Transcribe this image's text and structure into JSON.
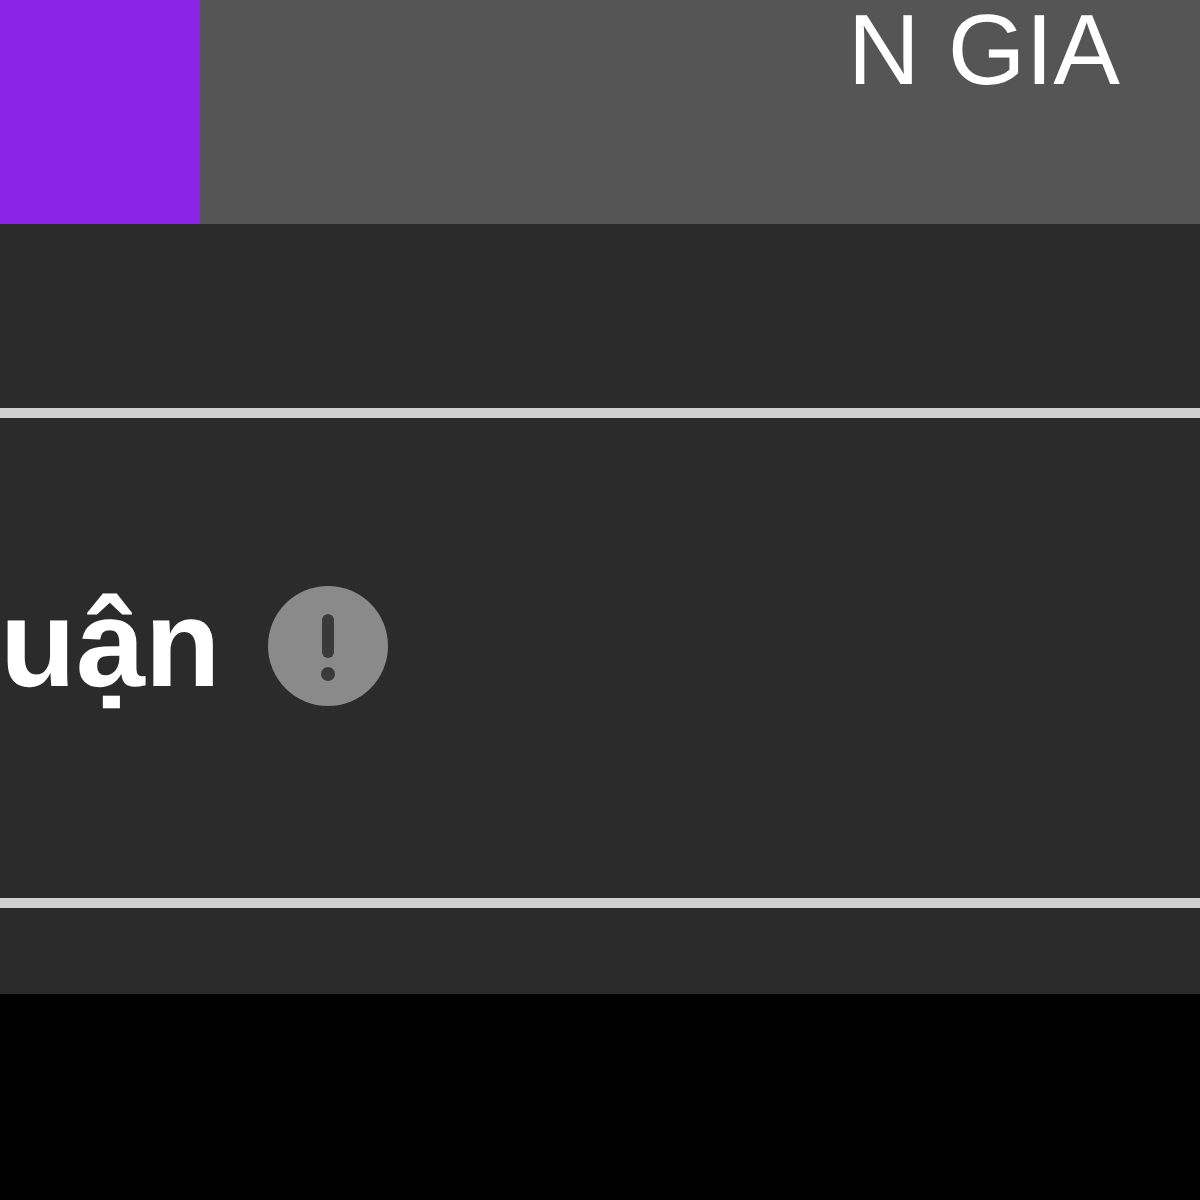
{
  "header": {
    "title": "N GIA"
  },
  "section": {
    "heading": "uận"
  }
}
